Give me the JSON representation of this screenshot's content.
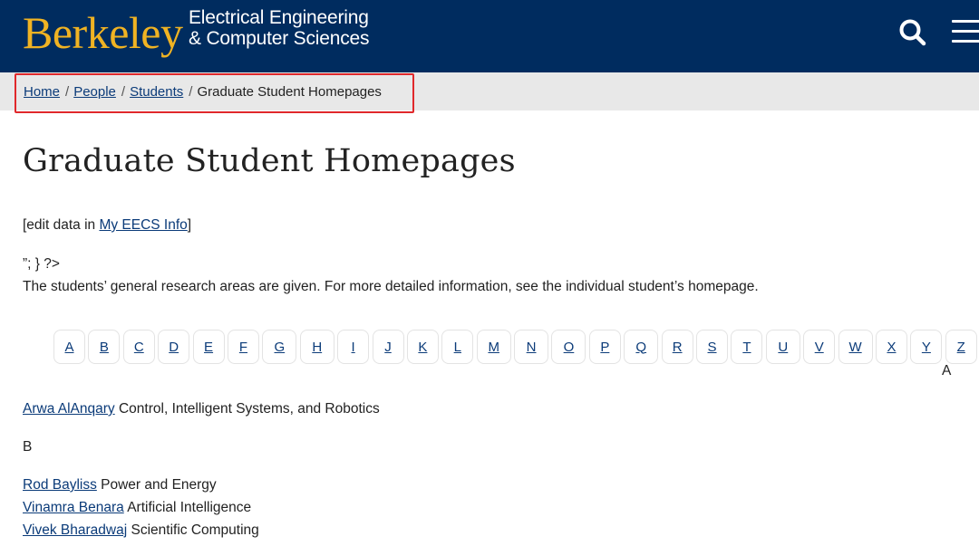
{
  "header": {
    "logo_text": "Berkeley",
    "dept_line1": "Electrical Engineering",
    "dept_line2": "& Computer Sciences",
    "brand_colors": {
      "navy": "#002c5f",
      "gold": "#f0b323"
    },
    "icons": [
      "search-icon",
      "hamburger-menu-icon"
    ]
  },
  "breadcrumb": {
    "items": [
      "Home",
      "People",
      "Students"
    ],
    "separator": "/",
    "current": "Graduate Student Homepages"
  },
  "main": {
    "title": "Graduate Student Homepages",
    "edit_prefix": "[edit data in ",
    "edit_link": "My EECS Info",
    "edit_suffix": "]",
    "stray_text": "”; } ?>",
    "intro": "The students’ general research areas are given. For more detailed information, see the individual student’s homepage."
  },
  "letters": [
    "A",
    "B",
    "C",
    "D",
    "E",
    "F",
    "G",
    "H",
    "I",
    "J",
    "K",
    "L",
    "M",
    "N",
    "O",
    "P",
    "Q",
    "R",
    "S",
    "T",
    "U",
    "V",
    "W",
    "X",
    "Y",
    "Z"
  ],
  "sections": {
    "A": {
      "heading": "A",
      "entries": [
        {
          "name": "Arwa AlAnqary",
          "area": "Control, Intelligent Systems, and Robotics"
        }
      ]
    },
    "B": {
      "heading": "B",
      "entries": [
        {
          "name": "Rod Bayliss",
          "area": "Power and Energy"
        },
        {
          "name": "Vinamra Benara",
          "area": "Artificial Intelligence"
        },
        {
          "name": "Vivek Bharadwaj",
          "area": "Scientific Computing"
        }
      ]
    }
  }
}
